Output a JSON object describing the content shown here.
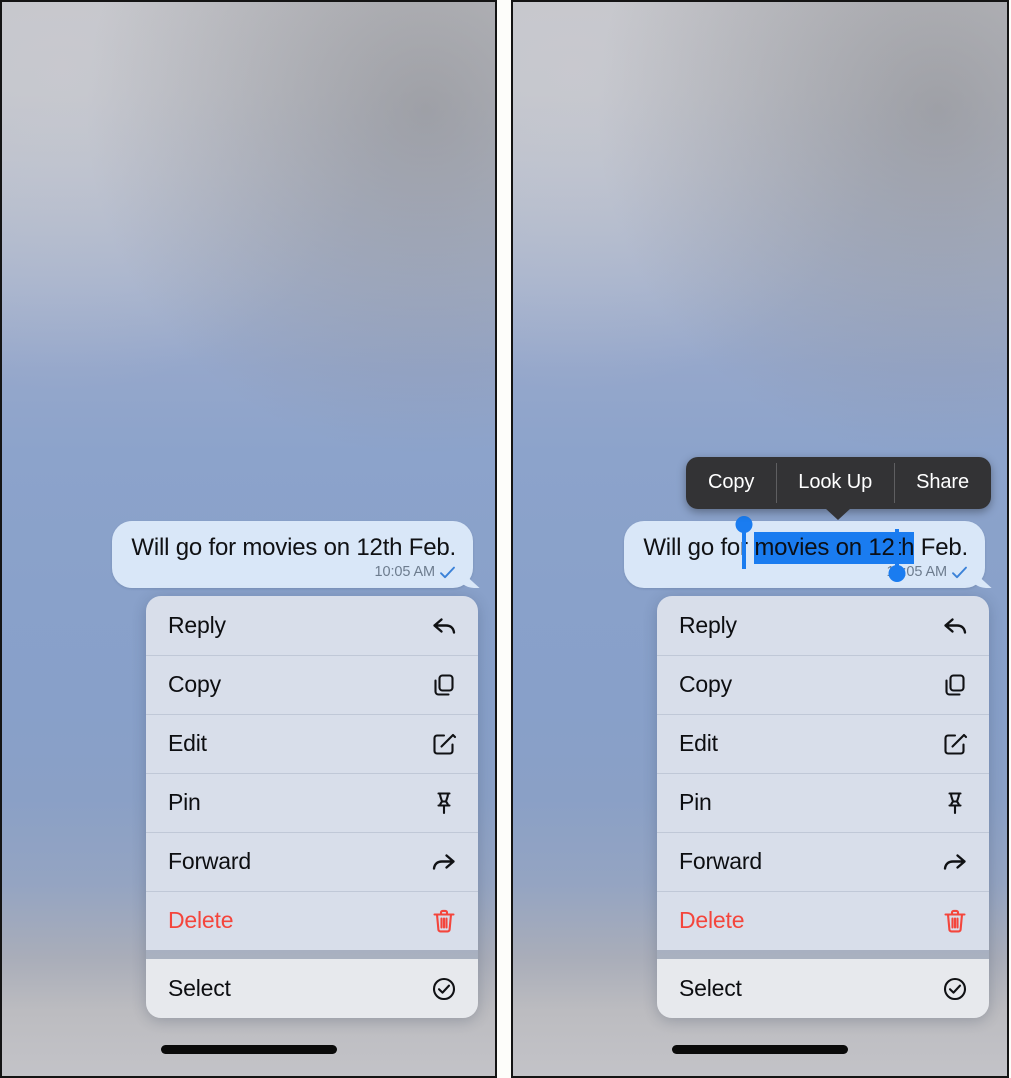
{
  "panels": [
    {
      "id": "left",
      "name": "context-menu-only",
      "message": {
        "text": "Will go for movies on 12th Feb.",
        "time": "10:05 AM",
        "status_icon": "double-check-icon",
        "bubble_color": "#d9e7f8"
      },
      "selection": {
        "active": false,
        "selected_text": ""
      },
      "edit_menu": {
        "visible": false,
        "items": []
      }
    },
    {
      "id": "right",
      "name": "text-selection-with-edit-menu",
      "message": {
        "text": "Will go for movies on 12th Feb.",
        "text_before": "Will go for ",
        "text_selected": "movies on 12th",
        "text_after": " Feb.",
        "time": "10:05 AM",
        "status_icon": "check-icon",
        "bubble_color": "#d9e7f8"
      },
      "selection": {
        "active": true,
        "selected_text": "movies on 12th",
        "highlight_color": "#1a7cf0",
        "handle_color": "#1a7cf0"
      },
      "edit_menu": {
        "visible": true,
        "background": "#333335",
        "items": [
          {
            "label": "Copy"
          },
          {
            "label": "Look Up"
          },
          {
            "label": "Share"
          }
        ]
      }
    }
  ],
  "context_menu": {
    "primary_items": [
      {
        "label": "Reply",
        "icon": "reply-arrow-icon",
        "danger": false
      },
      {
        "label": "Copy",
        "icon": "copy-pages-icon",
        "danger": false
      },
      {
        "label": "Edit",
        "icon": "pencil-square-icon",
        "danger": false
      },
      {
        "label": "Pin",
        "icon": "pushpin-icon",
        "danger": false
      },
      {
        "label": "Forward",
        "icon": "forward-arrow-icon",
        "danger": false
      },
      {
        "label": "Delete",
        "icon": "trash-icon",
        "danger": true
      }
    ],
    "secondary_items": [
      {
        "label": "Select",
        "icon": "check-circle-icon",
        "danger": false
      }
    ],
    "danger_color": "#f4453c",
    "background": "#d8deea",
    "secondary_background": "#e7e9ed"
  },
  "system": {
    "home_indicator": "home-indicator"
  }
}
